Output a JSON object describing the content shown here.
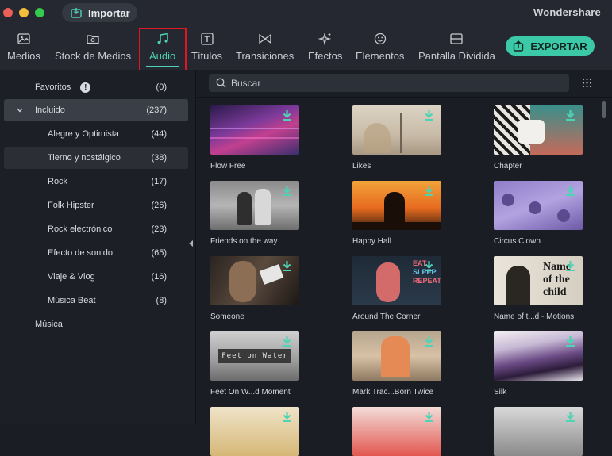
{
  "window": {
    "import_label": "Importar",
    "brand": "Wondershare",
    "traffic_colors": [
      "#ec5f58",
      "#f3bd3d",
      "#35c94d"
    ]
  },
  "toolbar": {
    "tabs": [
      {
        "label": "Medios",
        "icon": "image-icon"
      },
      {
        "label": "Stock de Medios",
        "icon": "folder-icon"
      },
      {
        "label": "Audio",
        "icon": "music-note-icon",
        "active": true
      },
      {
        "label": "Títulos",
        "icon": "text-icon"
      },
      {
        "label": "Transiciones",
        "icon": "transition-icon"
      },
      {
        "label": "Efectos",
        "icon": "sparkle-icon"
      },
      {
        "label": "Elementos",
        "icon": "smiley-icon"
      },
      {
        "label": "Pantalla Dividida",
        "icon": "split-screen-icon"
      }
    ],
    "export_label": "EXPORTAR",
    "accent": "#4ed3b7",
    "export_color": "#3bc9a8"
  },
  "sidebar": {
    "items": [
      {
        "label": "Favoritos",
        "count": "(0)"
      },
      {
        "label": "Incluido",
        "count": "(237)"
      },
      {
        "label": "Alegre y Optimista",
        "count": "(44)"
      },
      {
        "label": "Tierno y nostálgico",
        "count": "(38)"
      },
      {
        "label": "Rock",
        "count": "(17)"
      },
      {
        "label": "Folk Hipster",
        "count": "(26)"
      },
      {
        "label": "Rock electrónico",
        "count": "(23)"
      },
      {
        "label": "Efecto de sonido",
        "count": "(65)"
      },
      {
        "label": "Viaje & Vlog",
        "count": "(16)"
      },
      {
        "label": "Música Beat",
        "count": "(8)"
      },
      {
        "label": "Música",
        "count": ""
      }
    ]
  },
  "search": {
    "placeholder": "Buscar"
  },
  "tracks": [
    {
      "title": "Flow Free"
    },
    {
      "title": "Likes"
    },
    {
      "title": "Chapter"
    },
    {
      "title": "Friends on the way"
    },
    {
      "title": "Happy Hall"
    },
    {
      "title": "Circus Clown"
    },
    {
      "title": "Someone"
    },
    {
      "title": "Around The Corner"
    },
    {
      "title": "Name of t...d - Motions",
      "thumb_text": [
        "Name",
        "of the",
        "child"
      ]
    },
    {
      "title": "Feet On W...d Moment",
      "thumb_text": [
        "Feet on Water"
      ]
    },
    {
      "title": "Mark Trac...Born Twice"
    },
    {
      "title": "Silk"
    },
    {
      "title": ""
    },
    {
      "title": ""
    },
    {
      "title": ""
    }
  ],
  "thumb_overlays": {
    "around_the_corner": [
      "EAT",
      "SLEEP",
      "REPEAT"
    ]
  }
}
